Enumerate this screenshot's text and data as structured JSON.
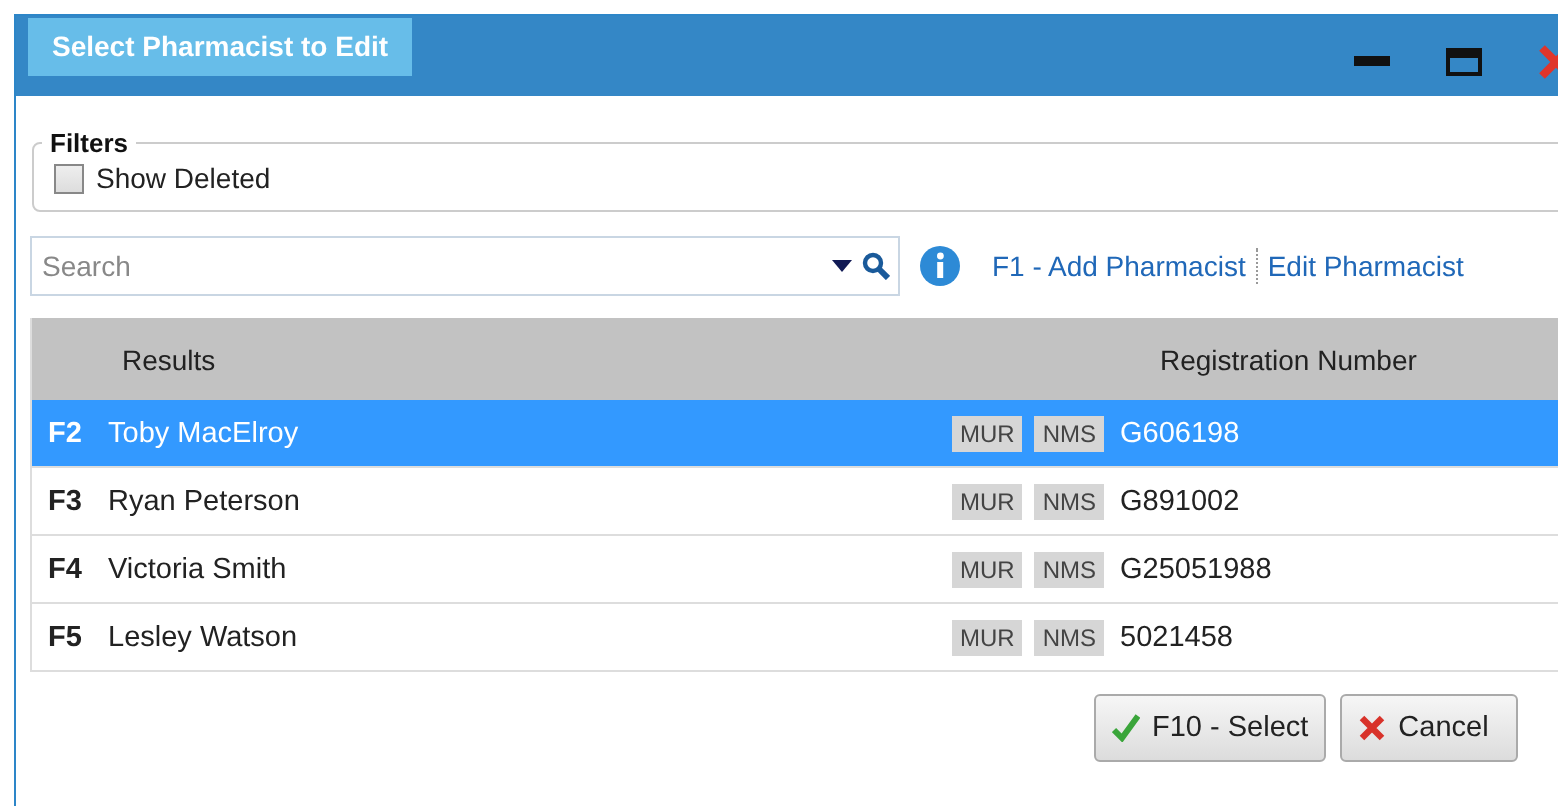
{
  "window": {
    "title": "Select Pharmacist to Edit"
  },
  "filters": {
    "title": "Filters",
    "show_deleted": {
      "label": "Show Deleted",
      "checked": false
    }
  },
  "search": {
    "placeholder": "Search"
  },
  "actions": [
    {
      "label": "F1 -  Add Pharmacist"
    },
    {
      "label": "Edit Pharmacist"
    }
  ],
  "table": {
    "columns": [
      "Results",
      "Registration Number"
    ],
    "rows": [
      {
        "key": "F2",
        "name": "Toby MacElroy",
        "tags": [
          "MUR",
          "NMS"
        ],
        "registration": "G606198",
        "selected": true
      },
      {
        "key": "F3",
        "name": "Ryan Peterson",
        "tags": [
          "MUR",
          "NMS"
        ],
        "registration": "G891002",
        "selected": false
      },
      {
        "key": "F4",
        "name": "Victoria Smith",
        "tags": [
          "MUR",
          "NMS"
        ],
        "registration": "G25051988",
        "selected": false
      },
      {
        "key": "F5",
        "name": "Lesley Watson",
        "tags": [
          "MUR",
          "NMS"
        ],
        "registration": "5021458",
        "selected": false
      }
    ]
  },
  "buttons": [
    {
      "kind": "ok",
      "label": "F10 -  Select"
    },
    {
      "kind": "cancel",
      "label": "Cancel"
    }
  ]
}
